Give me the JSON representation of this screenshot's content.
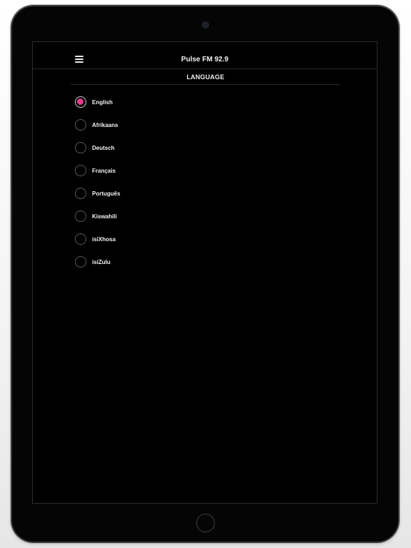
{
  "header": {
    "title": "Pulse FM 92.9"
  },
  "section": {
    "title": "LANGUAGE"
  },
  "languages": [
    {
      "label": "English",
      "selected": true
    },
    {
      "label": "Afrikaans",
      "selected": false
    },
    {
      "label": "Deutsch",
      "selected": false
    },
    {
      "label": "Français",
      "selected": false
    },
    {
      "label": "Português",
      "selected": false
    },
    {
      "label": "Kiswahili",
      "selected": false
    },
    {
      "label": "isiXhosa",
      "selected": false
    },
    {
      "label": "isiZulu",
      "selected": false
    }
  ],
  "colors": {
    "accent": "#e43d8c",
    "background": "#000000",
    "text": "#f4f4f4"
  },
  "icons": {
    "menu": "hamburger-menu-icon"
  }
}
